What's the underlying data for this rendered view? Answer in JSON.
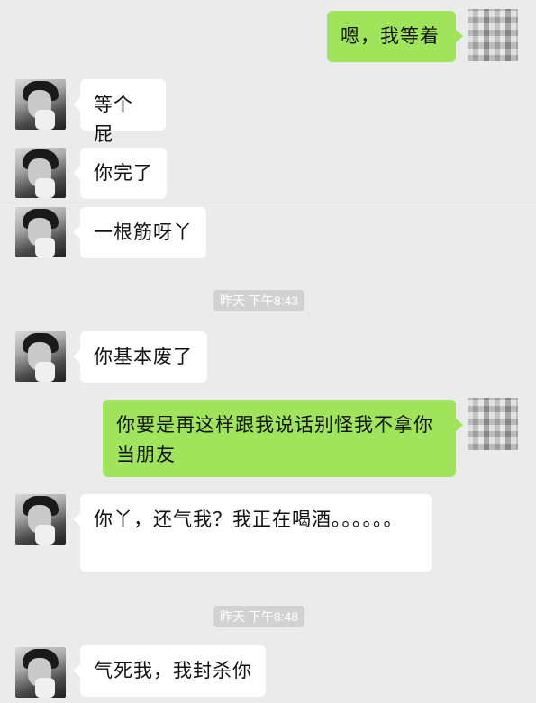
{
  "messages": [
    {
      "side": "right",
      "sender": "me",
      "text": "嗯，我等着"
    },
    {
      "side": "left",
      "sender": "friend",
      "text": "等个屁"
    },
    {
      "side": "left",
      "sender": "friend",
      "text": "你完了"
    },
    {
      "side": "left",
      "sender": "friend",
      "text": "一根筋呀丫"
    },
    {
      "side": "left",
      "sender": "friend",
      "text": "你基本废了"
    },
    {
      "side": "right",
      "sender": "me",
      "text": "你要是再这样跟我说话别怪我不拿你当朋友"
    },
    {
      "side": "left",
      "sender": "friend",
      "text": "你丫，还气我？我正在喝酒。。。。。。"
    },
    {
      "side": "left",
      "sender": "friend",
      "text": "气死我，我封杀你"
    }
  ],
  "timestamps": [
    "昨天 下午8:43",
    "昨天 下午8:48"
  ],
  "colors": {
    "background": "#ebebeb",
    "sent_bubble": "#9fe45a",
    "received_bubble": "#ffffff",
    "timestamp_bg": "#d2d2d2"
  },
  "icons": {
    "friend_avatar": "portrait-photo-avatar",
    "me_avatar": "pixelated-avatar"
  }
}
